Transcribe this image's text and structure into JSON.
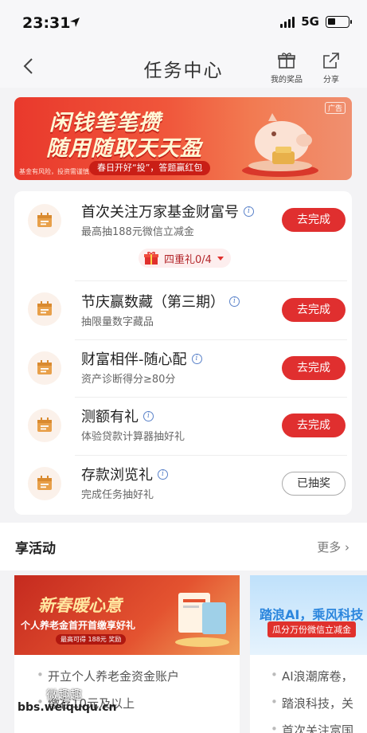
{
  "status_bar": {
    "time": "23:31",
    "network": "5G"
  },
  "nav": {
    "title": "任务中心",
    "my_prizes": "我的奖品",
    "share": "分享"
  },
  "banner": {
    "title_line1": "闲钱笔笔攒",
    "title_line2": "随用随取天天盈",
    "subtitle": "春日开好“投”，答题赢红包",
    "risk_note": "基金有风险，投资需谨慎",
    "ad_label": "广告"
  },
  "tasks": [
    {
      "title": "首次关注万家基金财富号",
      "desc": "最高抽188元微信立减金",
      "button": "去完成",
      "status": "todo"
    },
    {
      "title": "节庆赢数藏（第三期）",
      "desc": "抽限量数字藏品",
      "button": "去完成",
      "status": "todo"
    },
    {
      "title": "财富相伴-随心配",
      "desc": "资产诊断得分≥80分",
      "button": "去完成",
      "status": "todo"
    },
    {
      "title": "测额有礼",
      "desc": "体验贷款计算器抽好礼",
      "button": "去完成",
      "status": "todo"
    },
    {
      "title": "存款浏览礼",
      "desc": "完成任务抽好礼",
      "button": "已抽奖",
      "status": "done"
    }
  ],
  "gift_tag": "四重礼0/4",
  "section": {
    "title": "享活动",
    "more": "更多 ›"
  },
  "activities": [
    {
      "banner_title": "新春暖心意",
      "banner_sub": "个人养老金首开首缴享好礼",
      "banner_tag": "最高可得 188元 奖励",
      "lines": [
        "开立个人养老金资金账户",
        "缴存10元及以上"
      ]
    },
    {
      "banner_title": "踏浪AI，乘风科技",
      "banner_sub": "瓜分万份微信立减金",
      "lines": [
        "AI浪潮席卷，",
        "踏浪科技，关",
        "首次关注富国"
      ]
    }
  ],
  "watermark": {
    "line1": "微趣趣",
    "line2": "bbs.weiququ.cn"
  },
  "colors": {
    "accent": "#e02f2f",
    "icon_bg": "#fbf1ea",
    "icon_fg": "#e8a04a",
    "info": "#5a82c9"
  }
}
